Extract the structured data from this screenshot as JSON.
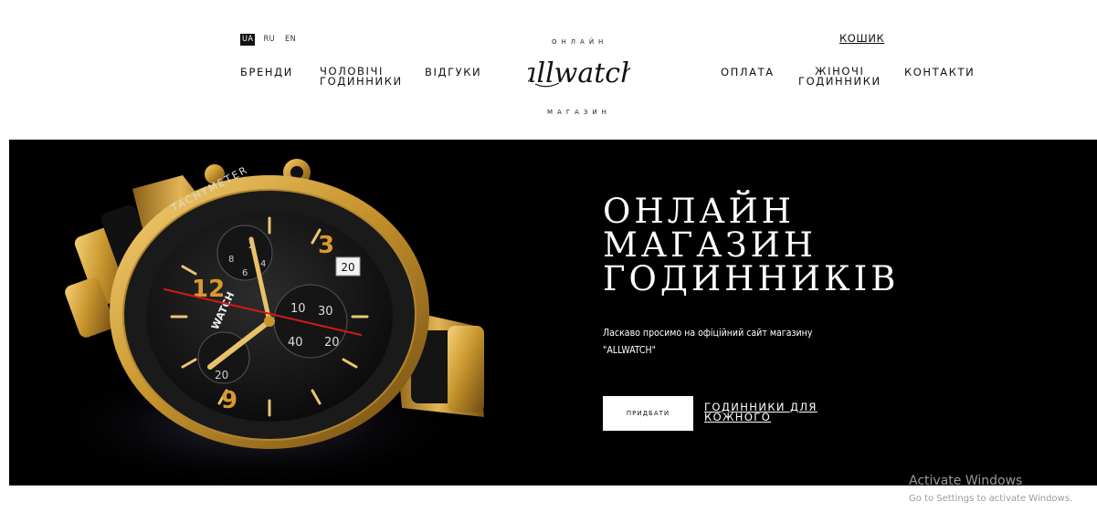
{
  "header": {
    "languages": [
      {
        "label": "UA",
        "active": true
      },
      {
        "label": "RU",
        "active": false
      },
      {
        "label": "EN",
        "active": false
      }
    ],
    "nav_left": [
      {
        "line1": "БРЕНДИ",
        "line2": ""
      },
      {
        "line1": "ЧОЛОВІЧІ",
        "line2": "ГОДИННИКИ"
      },
      {
        "line1": "ВІДГУКИ",
        "line2": ""
      }
    ],
    "nav_right": [
      {
        "line1": "ОПЛАТА",
        "line2": ""
      },
      {
        "line1": "ЖІНОЧІ",
        "line2": "ГОДИННИКИ"
      },
      {
        "line1": "КОНТАКТИ",
        "line2": ""
      }
    ],
    "cart_label": "КОШИК",
    "logo": {
      "top_text": "ОНЛАЙН",
      "name": "allwatch",
      "bottom_text": "МАГАЗИН"
    }
  },
  "hero": {
    "title_lines": [
      "ОНЛАЙН",
      "МАГАЗИН",
      "ГОДИННИКІВ"
    ],
    "subtitle": "Ласкаво просимо на офіційний сайт магазину \"ALLWATCH\"",
    "buy_button": "ПРИДБАТИ",
    "link_lines": [
      "ГОДИННИКИ ДЛЯ",
      "КОЖНОГО"
    ],
    "watch_dial": {
      "numerals": [
        "12",
        "3",
        "9"
      ],
      "date": "20",
      "brand": "WATCH",
      "bezel_text": "TACHYMETER",
      "sub_numbers": [
        "10",
        "20",
        "30",
        "40",
        "2",
        "4",
        "6",
        "8"
      ]
    }
  },
  "watermark": {
    "title": "Activate Windows",
    "subtitle": "Go to Settings to activate Windows."
  },
  "colors": {
    "hero_bg": "#000000",
    "gold": "#c9962e",
    "accent_red": "#d11a1a",
    "watermark": "#9a9a9a"
  }
}
